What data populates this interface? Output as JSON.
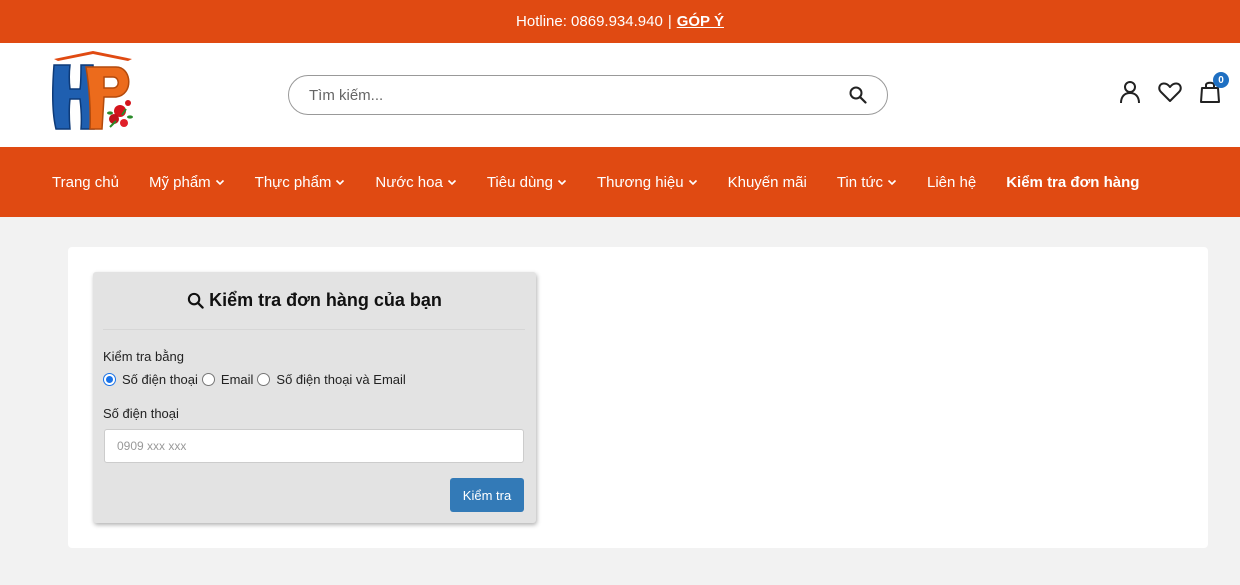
{
  "topbar": {
    "hotline": "Hotline: 0869.934.940",
    "separator": "|",
    "feedback": "GÓP Ý"
  },
  "header": {
    "logo_text": "HP",
    "search": {
      "placeholder": "Tìm kiếm...",
      "icon": "search-icon"
    },
    "icons": {
      "account": "user-icon",
      "wishlist": "heart-icon",
      "cart": "shopping-bag-icon"
    },
    "cart_count": "0"
  },
  "nav": {
    "items": [
      {
        "label": "Trang chủ",
        "dropdown": false
      },
      {
        "label": "Mỹ phẩm",
        "dropdown": true
      },
      {
        "label": "Thực phẩm",
        "dropdown": true
      },
      {
        "label": "Nước hoa",
        "dropdown": true
      },
      {
        "label": "Tiêu dùng",
        "dropdown": true
      },
      {
        "label": "Thương hiệu",
        "dropdown": true
      },
      {
        "label": "Khuyến mãi",
        "dropdown": false
      },
      {
        "label": "Tin tức",
        "dropdown": true
      },
      {
        "label": "Liên hệ",
        "dropdown": false
      },
      {
        "label": "Kiểm tra đơn hàng",
        "dropdown": false,
        "active": true
      }
    ]
  },
  "order_check": {
    "title": "Kiểm tra đơn hàng của bạn",
    "check_by_label": "Kiểm tra bằng",
    "options": [
      {
        "label": "Số điện thoại",
        "checked": true
      },
      {
        "label": "Email",
        "checked": false
      },
      {
        "label": "Số điện thoại và Email",
        "checked": false
      }
    ],
    "phone_label": "Số điện thoại",
    "phone_value": "",
    "phone_placeholder": "0909 xxx xxx",
    "submit_label": "Kiểm tra"
  },
  "colors": {
    "brand_orange": "#e04a12",
    "button_blue": "#337ab7",
    "badge_blue": "#1e6fc2"
  }
}
